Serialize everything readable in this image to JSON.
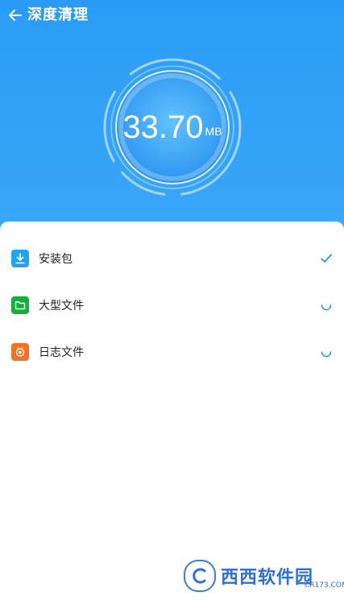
{
  "header": {
    "title": "深度清理"
  },
  "gauge": {
    "value": "33.70",
    "unit": "MB"
  },
  "items": [
    {
      "label": "安装包",
      "icon": "download-icon",
      "icon_color": "#21a3f1",
      "status": "done"
    },
    {
      "label": "大型文件",
      "icon": "folder-icon",
      "icon_color": "#12b137",
      "status": "loading"
    },
    {
      "label": "日志文件",
      "icon": "log-icon",
      "icon_color": "#f0711f",
      "status": "loading"
    }
  ],
  "watermark": {
    "text": "西西软件园",
    "sub": "CR173.COM"
  },
  "colors": {
    "primary": "#2a9cf5",
    "accent": "#1f8ff0"
  }
}
